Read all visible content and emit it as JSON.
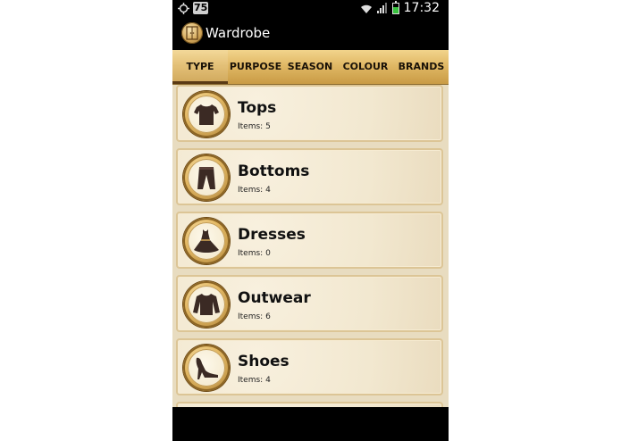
{
  "status_bar": {
    "notification_badge": "75",
    "time": "17:32",
    "battery_level": 0.6
  },
  "app": {
    "title": "Wardrobe",
    "icon": "wardrobe-icon"
  },
  "tabs": [
    {
      "label": "TYPE",
      "active": true
    },
    {
      "label": "PURPOSE",
      "active": false
    },
    {
      "label": "SEASON",
      "active": false
    },
    {
      "label": "COLOUR",
      "active": false
    },
    {
      "label": "BRANDS",
      "active": false
    }
  ],
  "categories": [
    {
      "name": "Tops",
      "count_text": "Items: 5",
      "icon": "shirt-icon"
    },
    {
      "name": "Bottoms",
      "count_text": "Items: 4",
      "icon": "trousers-icon"
    },
    {
      "name": "Dresses",
      "count_text": "Items: 0",
      "icon": "dress-icon"
    },
    {
      "name": "Outwear",
      "count_text": "Items: 6",
      "icon": "sweater-icon"
    },
    {
      "name": "Shoes",
      "count_text": "Items: 4",
      "icon": "high-heel-icon"
    }
  ],
  "colors": {
    "tab_gold": "#e0b865",
    "card_bg": "#f2e8d0",
    "icon_dark": "#3b2a24"
  }
}
